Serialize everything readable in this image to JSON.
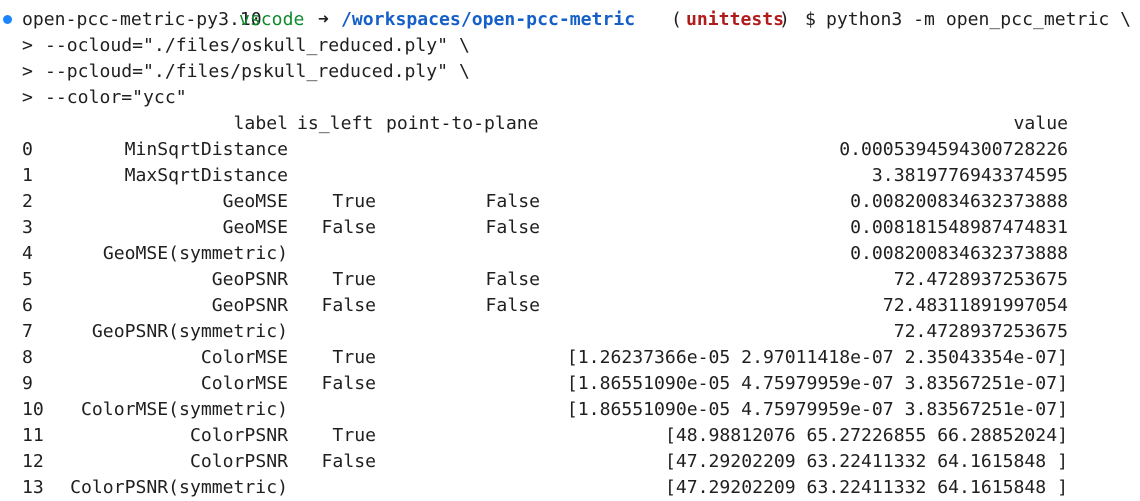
{
  "terminal": {
    "prompt": {
      "env": "open-pcc-metric-py3.10",
      "user": "vscode",
      "arrow": "➜",
      "cwd": "/workspaces/open-pcc-metric",
      "branch_open": "(",
      "branch": "unittests",
      "branch_close": ")",
      "dollar": "$",
      "command": "python3 -m open_pcc_metric \\"
    },
    "continuation_prompt": ">",
    "continuation_lines": [
      "--ocloud=\"./files/oskull_reduced.ply\" \\",
      "--pcloud=\"./files/pskull_reduced.ply\" \\",
      "--color=\"ycc\""
    ],
    "status_color": "#1a85ff"
  },
  "table": {
    "headers": {
      "label": "label",
      "is_left": "is_left",
      "point_to_plane": "point-to-plane",
      "value": "value"
    },
    "rows": [
      {
        "index": "0",
        "label": "MinSqrtDistance",
        "is_left": "",
        "point_to_plane": "",
        "value": "0.0005394594300728226"
      },
      {
        "index": "1",
        "label": "MaxSqrtDistance",
        "is_left": "",
        "point_to_plane": "",
        "value": "3.3819776943374595"
      },
      {
        "index": "2",
        "label": "GeoMSE",
        "is_left": "True",
        "point_to_plane": "False",
        "value": "0.008200834632373888"
      },
      {
        "index": "3",
        "label": "GeoMSE",
        "is_left": "False",
        "point_to_plane": "False",
        "value": "0.008181548987474831"
      },
      {
        "index": "4",
        "label": "GeoMSE(symmetric)",
        "is_left": "",
        "point_to_plane": "",
        "value": "0.008200834632373888"
      },
      {
        "index": "5",
        "label": "GeoPSNR",
        "is_left": "True",
        "point_to_plane": "False",
        "value": "72.4728937253675"
      },
      {
        "index": "6",
        "label": "GeoPSNR",
        "is_left": "False",
        "point_to_plane": "False",
        "value": "72.48311891997054"
      },
      {
        "index": "7",
        "label": "GeoPSNR(symmetric)",
        "is_left": "",
        "point_to_plane": "",
        "value": "72.4728937253675"
      },
      {
        "index": "8",
        "label": "ColorMSE",
        "is_left": "True",
        "point_to_plane": "",
        "value": "[1.26237366e-05 2.97011418e-07 2.35043354e-07]"
      },
      {
        "index": "9",
        "label": "ColorMSE",
        "is_left": "False",
        "point_to_plane": "",
        "value": "[1.86551090e-05 4.75979959e-07 3.83567251e-07]"
      },
      {
        "index": "10",
        "label": "ColorMSE(symmetric)",
        "is_left": "",
        "point_to_plane": "",
        "value": "[1.86551090e-05 4.75979959e-07 3.83567251e-07]"
      },
      {
        "index": "11",
        "label": "ColorPSNR",
        "is_left": "True",
        "point_to_plane": "",
        "value": "[48.98812076 65.27226855 66.28852024]"
      },
      {
        "index": "12",
        "label": "ColorPSNR",
        "is_left": "False",
        "point_to_plane": "",
        "value": "[47.29202209 63.22411332 64.1615848 ]"
      },
      {
        "index": "13",
        "label": "ColorPSNR(symmetric)",
        "is_left": "",
        "point_to_plane": "",
        "value": "[47.29202209 63.22411332 64.1615848 ]"
      }
    ]
  }
}
